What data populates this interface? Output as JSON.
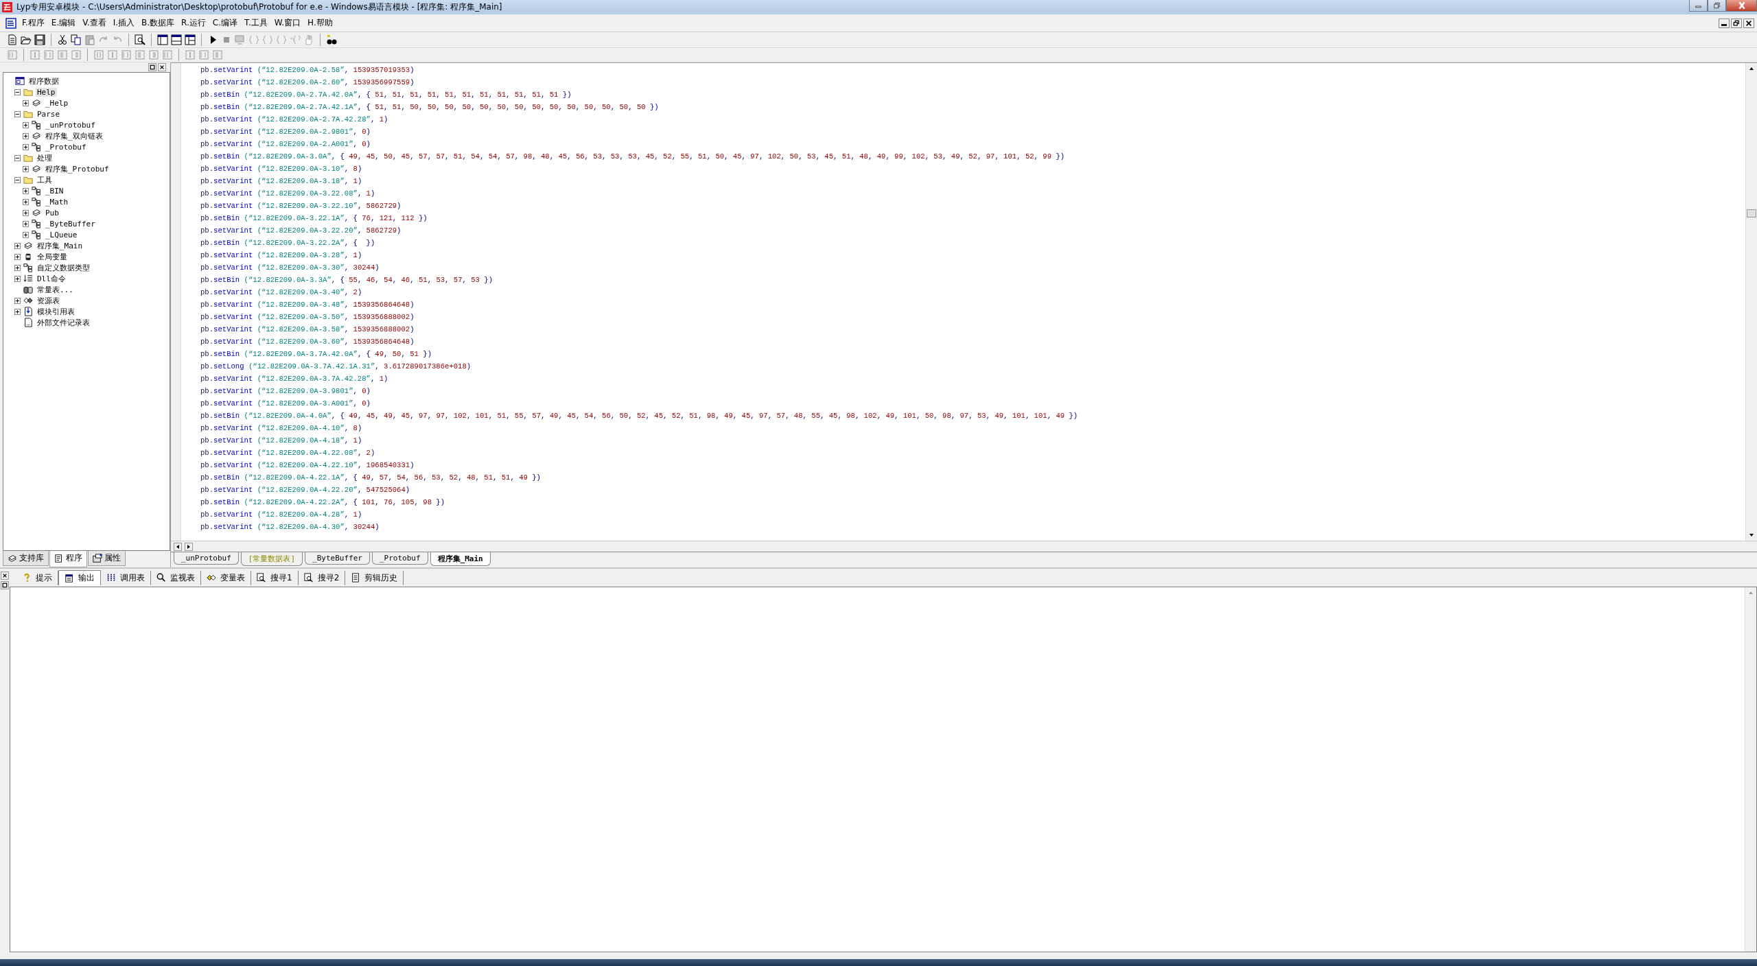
{
  "window": {
    "title": "Lyp专用安卓模块 - C:\\Users\\Administrator\\Desktop\\protobuf\\Protobuf for e.e - Windows易语言模块 - [程序集: 程序集_Main]"
  },
  "menu": [
    "F.程序",
    "E.编辑",
    "V.查看",
    "I.插入",
    "B.数据库",
    "R.运行",
    "C.编译",
    "T.工具",
    "W.窗口",
    "H.帮助"
  ],
  "tree": {
    "items": [
      {
        "label": "程序数据",
        "kind": "project",
        "selected": false,
        "children": [
          {
            "label": "Help",
            "kind": "folder",
            "expanded": true,
            "selected": true,
            "children": [
              {
                "label": "_Help",
                "kind": "module",
                "expanded": false,
                "selected": false
              }
            ]
          },
          {
            "label": "Parse",
            "kind": "folder",
            "expanded": true,
            "selected": false,
            "children": [
              {
                "label": "_unProtobuf",
                "kind": "class",
                "expanded": false,
                "selected": false
              },
              {
                "label": "程序集_双向链表",
                "kind": "module",
                "expanded": false,
                "selected": false
              },
              {
                "label": "_Protobuf",
                "kind": "class",
                "expanded": false,
                "selected": false
              }
            ]
          },
          {
            "label": "处理",
            "kind": "folder",
            "expanded": true,
            "selected": false,
            "children": [
              {
                "label": "程序集_Protobuf",
                "kind": "module",
                "expanded": false,
                "selected": false
              }
            ]
          },
          {
            "label": "工具",
            "kind": "folder",
            "expanded": true,
            "selected": false,
            "children": [
              {
                "label": "_BIN",
                "kind": "class",
                "expanded": false,
                "selected": false
              },
              {
                "label": "_Math",
                "kind": "class",
                "expanded": false,
                "selected": false
              },
              {
                "label": "Pub",
                "kind": "module",
                "expanded": false,
                "selected": false
              },
              {
                "label": "_ByteBuffer",
                "kind": "class",
                "expanded": false,
                "selected": false
              },
              {
                "label": "_LQueue",
                "kind": "class",
                "expanded": false,
                "selected": false
              }
            ]
          },
          {
            "label": "程序集_Main",
            "kind": "module",
            "expanded": false,
            "selected": false
          },
          {
            "label": "全局变量",
            "kind": "global",
            "expanded": false,
            "selected": false
          },
          {
            "label": "自定义数据类型",
            "kind": "class",
            "expanded": false,
            "selected": false
          },
          {
            "label": "Dll命令",
            "kind": "dll",
            "expanded": false,
            "selected": false
          },
          {
            "label": "常量表...",
            "kind": "const",
            "selected": false
          },
          {
            "label": "资源表",
            "kind": "resource",
            "expanded": false,
            "selected": false
          },
          {
            "label": "模块引用表",
            "kind": "import",
            "expanded": false,
            "selected": false
          },
          {
            "label": "外部文件记录表",
            "kind": "file",
            "selected": false
          }
        ]
      }
    ]
  },
  "left_tabs": [
    {
      "label": "支持库",
      "kind": "module",
      "selected": false
    },
    {
      "label": "程序",
      "kind": "program",
      "selected": true
    },
    {
      "label": "属性",
      "kind": "props",
      "selected": false
    }
  ],
  "code": [
    {
      "call": "pb.setVarint",
      "key": "(“12.82E209.0A-2.58”",
      "args": ", 1539357019353)"
    },
    {
      "call": "pb.setVarint",
      "key": "(“12.82E209.0A-2.60”",
      "args": ", 1539356997559)"
    },
    {
      "call": "pb.setBin",
      "key": "(“12.82E209.0A-2.7A.42.0A”",
      "args": ", { 51, 51, 51, 51, 51, 51, 51, 51, 51, 51, 51 })"
    },
    {
      "call": "pb.setBin",
      "key": "(“12.82E209.0A-2.7A.42.1A”",
      "args": ", { 51, 51, 50, 50, 50, 50, 50, 50, 50, 50, 50, 50, 50, 50, 50, 50 })"
    },
    {
      "call": "pb.setVarint",
      "key": "(“12.82E209.0A-2.7A.42.28”",
      "args": ", 1)"
    },
    {
      "call": "pb.setVarint",
      "key": "(“12.82E209.0A-2.9801”",
      "args": ", 0)"
    },
    {
      "call": "pb.setVarint",
      "key": "(“12.82E209.0A-2.A001”",
      "args": ", 0)"
    },
    {
      "call": "pb.setBin",
      "key": "(“12.82E209.0A-3.0A”",
      "args": ", { 49, 45, 50, 45, 57, 57, 51, 54, 54, 57, 98, 48, 45, 56, 53, 53, 53, 45, 52, 55, 51, 50, 45, 97, 102, 50, 53, 45, 51, 48, 49, 99, 102, 53, 49, 52, 97, 101, 52, 99 })"
    },
    {
      "call": "pb.setVarint",
      "key": "(“12.82E209.0A-3.10”",
      "args": ", 8)"
    },
    {
      "call": "pb.setVarint",
      "key": "(“12.82E209.0A-3.18”",
      "args": ", 1)"
    },
    {
      "call": "pb.setVarint",
      "key": "(“12.82E209.0A-3.22.08”",
      "args": ", 1)"
    },
    {
      "call": "pb.setVarint",
      "key": "(“12.82E209.0A-3.22.10”",
      "args": ", 5862729)"
    },
    {
      "call": "pb.setBin",
      "key": "(“12.82E209.0A-3.22.1A”",
      "args": ", { 76, 121, 112 })"
    },
    {
      "call": "pb.setVarint",
      "key": "(“12.82E209.0A-3.22.20”",
      "args": ", 5862729)"
    },
    {
      "call": "pb.setBin",
      "key": "(“12.82E209.0A-3.22.2A”",
      "args": ", {  })"
    },
    {
      "call": "pb.setVarint",
      "key": "(“12.82E209.0A-3.28”",
      "args": ", 1)"
    },
    {
      "call": "pb.setVarint",
      "key": "(“12.82E209.0A-3.30”",
      "args": ", 30244)"
    },
    {
      "call": "pb.setBin",
      "key": "(“12.82E209.0A-3.3A”",
      "args": ", { 55, 46, 54, 46, 51, 53, 57, 53 })"
    },
    {
      "call": "pb.setVarint",
      "key": "(“12.82E209.0A-3.40”",
      "args": ", 2)"
    },
    {
      "call": "pb.setVarint",
      "key": "(“12.82E209.0A-3.48”",
      "args": ", 1539356864648)"
    },
    {
      "call": "pb.setVarint",
      "key": "(“12.82E209.0A-3.50”",
      "args": ", 1539356888002)"
    },
    {
      "call": "pb.setVarint",
      "key": "(“12.82E209.0A-3.58”",
      "args": ", 1539356888002)"
    },
    {
      "call": "pb.setVarint",
      "key": "(“12.82E209.0A-3.60”",
      "args": ", 1539356864648)"
    },
    {
      "call": "pb.setBin",
      "key": "(“12.82E209.0A-3.7A.42.0A”",
      "args": ", { 49, 50, 51 })"
    },
    {
      "call": "pb.setLong",
      "key": "(“12.82E209.0A-3.7A.42.1A.31”",
      "args": ", 3.617289017386e+018)"
    },
    {
      "call": "pb.setVarint",
      "key": "(“12.82E209.0A-3.7A.42.28”",
      "args": ", 1)"
    },
    {
      "call": "pb.setVarint",
      "key": "(“12.82E209.0A-3.9801”",
      "args": ", 0)"
    },
    {
      "call": "pb.setVarint",
      "key": "(“12.82E209.0A-3.A001”",
      "args": ", 0)"
    },
    {
      "call": "pb.setBin",
      "key": "(“12.82E209.0A-4.0A”",
      "args": ", { 49, 45, 49, 45, 97, 97, 102, 101, 51, 55, 57, 49, 45, 54, 56, 50, 52, 45, 52, 51, 98, 49, 45, 97, 57, 48, 55, 45, 98, 102, 49, 101, 50, 98, 97, 53, 49, 101, 101, 49 })"
    },
    {
      "call": "pb.setVarint",
      "key": "(“12.82E209.0A-4.10”",
      "args": ", 8)"
    },
    {
      "call": "pb.setVarint",
      "key": "(“12.82E209.0A-4.18”",
      "args": ", 1)"
    },
    {
      "call": "pb.setVarint",
      "key": "(“12.82E209.0A-4.22.08”",
      "args": ", 2)"
    },
    {
      "call": "pb.setVarint",
      "key": "(“12.82E209.0A-4.22.10”",
      "args": ", 1968540331)"
    },
    {
      "call": "pb.setBin",
      "key": "(“12.82E209.0A-4.22.1A”",
      "args": ", { 49, 57, 54, 56, 53, 52, 48, 51, 51, 49 })"
    },
    {
      "call": "pb.setVarint",
      "key": "(“12.82E209.0A-4.22.20”",
      "args": ", 547525064)"
    },
    {
      "call": "pb.setBin",
      "key": "(“12.82E209.0A-4.22.2A”",
      "args": ", { 101, 76, 105, 98 })"
    },
    {
      "call": "pb.setVarint",
      "key": "(“12.82E209.0A-4.28”",
      "args": ", 1)"
    },
    {
      "call": "pb.setVarint",
      "key": "(“12.82E209.0A-4.30”",
      "args": ", 30244)"
    }
  ],
  "code_tabs": [
    {
      "label": "_unProtobuf",
      "kind": "class",
      "selected": false
    },
    {
      "label": "[常量数据表]",
      "kind": "table",
      "selected": false
    },
    {
      "label": "_ByteBuffer",
      "kind": "class",
      "selected": false
    },
    {
      "label": "_Protobuf",
      "kind": "class",
      "selected": false
    },
    {
      "label": "程序集_Main",
      "kind": "class",
      "selected": true
    }
  ],
  "output_tabs": [
    {
      "label": "提示",
      "kind": "help",
      "selected": false
    },
    {
      "label": "输出",
      "kind": "output",
      "selected": true
    },
    {
      "label": "调用表",
      "kind": "calls",
      "selected": false
    },
    {
      "label": "监视表",
      "kind": "search",
      "selected": false
    },
    {
      "label": "变量表",
      "kind": "vars",
      "selected": false
    },
    {
      "label": "搜寻1",
      "kind": "find",
      "selected": false
    },
    {
      "label": "搜寻2",
      "kind": "find",
      "selected": false
    },
    {
      "label": "剪辑历史",
      "kind": "clip",
      "selected": false
    }
  ]
}
